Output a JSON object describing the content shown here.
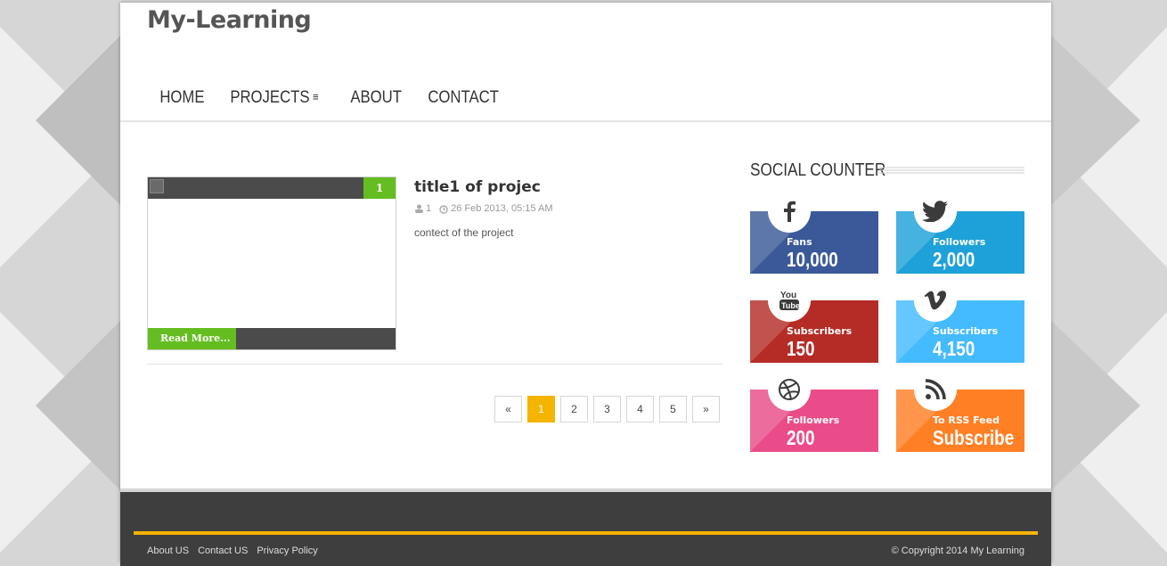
{
  "site": {
    "title": "My-Learning"
  },
  "nav": {
    "items": [
      {
        "label": "HOME"
      },
      {
        "label": "PROJECTS"
      },
      {
        "label": "ABOUT"
      },
      {
        "label": "CONTACT"
      }
    ],
    "active_index": 0
  },
  "post": {
    "badge": "1",
    "title": "title1 of projec",
    "author_count": "1",
    "date": "26 Feb 2013, 05:15 AM",
    "excerpt": "contect of the project",
    "read_more": "Read More..."
  },
  "pagination": {
    "prev": "«",
    "pages": [
      "1",
      "2",
      "3",
      "4",
      "5"
    ],
    "current": "1",
    "next": "»"
  },
  "sidebar": {
    "title": "SOCIAL COUNTER",
    "counters": [
      {
        "network": "facebook",
        "icon": "facebook-icon",
        "label": "Fans",
        "value": "10,000",
        "color": "#3b5998"
      },
      {
        "network": "twitter",
        "icon": "twitter-icon",
        "label": "Followers",
        "value": "2,000",
        "color": "#1da1d8"
      },
      {
        "network": "youtube",
        "icon": "youtube-icon",
        "label": "Subscribers",
        "value": "150",
        "color": "#b52c26"
      },
      {
        "network": "vimeo",
        "icon": "vimeo-icon",
        "label": "Subscribers",
        "value": "4,150",
        "color": "#45bbff"
      },
      {
        "network": "dribbble",
        "icon": "dribbble-icon",
        "label": "Followers",
        "value": "200",
        "color": "#ea4c89"
      },
      {
        "network": "rss",
        "icon": "rss-icon",
        "label": "To RSS Feed",
        "value": "Subscribe",
        "color": "#ff7f25"
      }
    ]
  },
  "footer": {
    "links": [
      "About US",
      "Contact US",
      "Privacy Policy"
    ],
    "copyright": "© Copyright 2014 My Learning"
  },
  "colors": {
    "accent": "#f4b400",
    "green": "#65bd21",
    "footer_bg": "#3e3e3e"
  }
}
